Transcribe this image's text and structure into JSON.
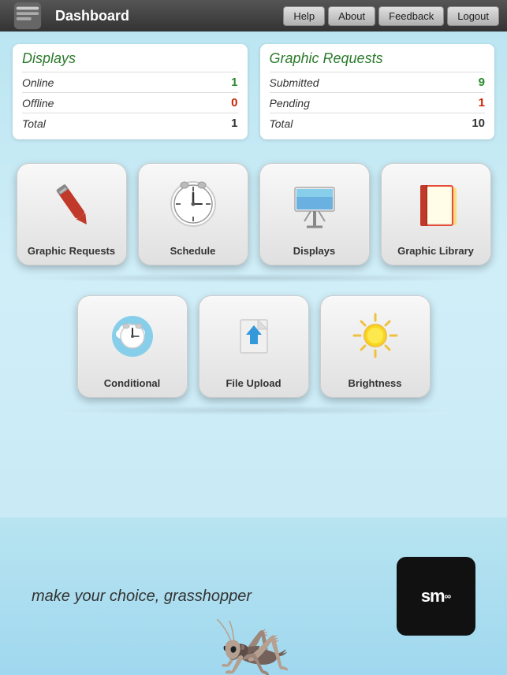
{
  "header": {
    "title": "Dashboard",
    "nav": {
      "help": "Help",
      "about": "About",
      "feedback": "Feedback",
      "logout": "Logout"
    }
  },
  "stats": {
    "displays": {
      "title": "Displays",
      "rows": [
        {
          "label": "Online",
          "value": "1",
          "color": "green"
        },
        {
          "label": "Offline",
          "value": "0",
          "color": "red"
        },
        {
          "label": "Total",
          "value": "1",
          "color": "black"
        }
      ]
    },
    "graphic_requests": {
      "title": "Graphic Requests",
      "rows": [
        {
          "label": "Submitted",
          "value": "9",
          "color": "green"
        },
        {
          "label": "Pending",
          "value": "1",
          "color": "red"
        },
        {
          "label": "Total",
          "value": "10",
          "color": "black"
        }
      ]
    }
  },
  "tiles_row1": [
    {
      "id": "graphic-requests",
      "label": "Graphic Requests",
      "icon": "pen"
    },
    {
      "id": "schedule",
      "label": "Schedule",
      "icon": "clock"
    },
    {
      "id": "displays",
      "label": "Displays",
      "icon": "billboard"
    },
    {
      "id": "graphic-library",
      "label": "Graphic Library",
      "icon": "book"
    }
  ],
  "tiles_row2": [
    {
      "id": "conditional",
      "label": "Conditional",
      "icon": "conditional-clock"
    },
    {
      "id": "file-upload",
      "label": "File Upload",
      "icon": "upload"
    },
    {
      "id": "brightness",
      "label": "Brightness",
      "icon": "sun"
    }
  ],
  "bottom": {
    "tagline": "make your choice, grasshopper",
    "logo_text": "sm"
  }
}
